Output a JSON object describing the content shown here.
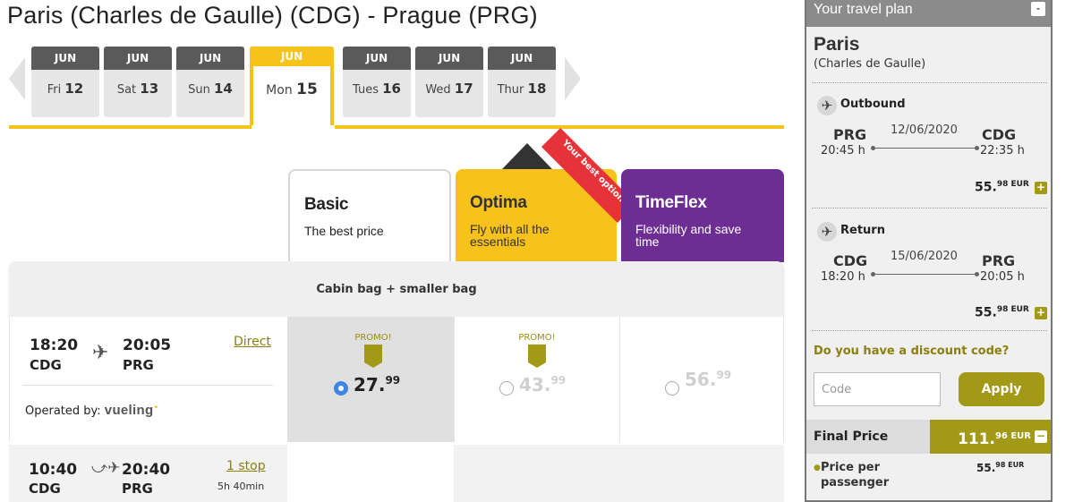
{
  "route_title": "Paris (Charles de Gaulle) (CDG) - Prague (PRG)",
  "dates": [
    {
      "month": "JUN",
      "weekday": "Fri",
      "day": "12"
    },
    {
      "month": "JUN",
      "weekday": "Sat",
      "day": "13"
    },
    {
      "month": "JUN",
      "weekday": "Sun",
      "day": "14"
    },
    {
      "month": "JUN",
      "weekday": "Mon",
      "day": "15"
    },
    {
      "month": "JUN",
      "weekday": "Tues",
      "day": "16"
    },
    {
      "month": "JUN",
      "weekday": "Wed",
      "day": "17"
    },
    {
      "month": "JUN",
      "weekday": "Thur",
      "day": "18"
    }
  ],
  "selected_date_index": 3,
  "fares": {
    "basic": {
      "name": "Basic",
      "desc": "The best price"
    },
    "optima": {
      "name": "Optima",
      "desc": "Fly with all the essentials",
      "ribbon": "Your best option"
    },
    "timeflex": {
      "name": "TimeFlex",
      "desc": "Flexibility and save time"
    }
  },
  "colors": {
    "optima": "#f7c21c",
    "timeflex": "#6d2e93",
    "ribbon": "#e63339",
    "olive": "#a29916",
    "selected_radio": "#3f86e0"
  },
  "bag_bar": "Cabin bag + smaller bag",
  "flights": [
    {
      "dep_time": "18:20",
      "dep_code": "CDG",
      "arr_time": "20:05",
      "arr_code": "PRG",
      "stops_link": "Direct",
      "operated_label": "Operated by:",
      "carrier": "vueling",
      "promo_basic": "PROMO!",
      "promo_optima": "PROMO!",
      "price_basic": "27.",
      "price_basic_dec": "99",
      "price_optima": "43.",
      "price_optima_dec": "99",
      "price_timeflex": "56.",
      "price_timeflex_dec": "99",
      "selected": "basic"
    },
    {
      "dep_time": "10:40",
      "dep_code": "CDG",
      "arr_time": "20:40",
      "arr_code": "PRG",
      "stops_link": "1 stop",
      "duration": "5h 40min"
    }
  ],
  "sidebar": {
    "title": "Your travel plan",
    "minimize": "-",
    "city": "Paris",
    "city_full": "(Charles de Gaulle)",
    "outbound": {
      "label": "Outbound",
      "from_code": "PRG",
      "to_code": "CDG",
      "date": "12/06/2020",
      "from_time": "20:45 h",
      "to_time": "22:35 h",
      "price": "55.",
      "price_dec": "98 EUR",
      "icon": "plane-icon"
    },
    "return": {
      "label": "Return",
      "from_code": "CDG",
      "to_code": "PRG",
      "date": "15/06/2020",
      "from_time": "18:20 h",
      "to_time": "20:05 h",
      "price": "55.",
      "price_dec": "98 EUR",
      "icon": "plane-icon"
    },
    "discount_question": "Do you have a discount code?",
    "code_placeholder": "Code",
    "apply_label": "Apply",
    "final_label": "Final Price",
    "final_price": "111.",
    "final_price_dec": "96 EUR",
    "per_passenger_label": "Price per passenger",
    "per_passenger_price": "55.",
    "per_passenger_dec": "98 EUR"
  }
}
